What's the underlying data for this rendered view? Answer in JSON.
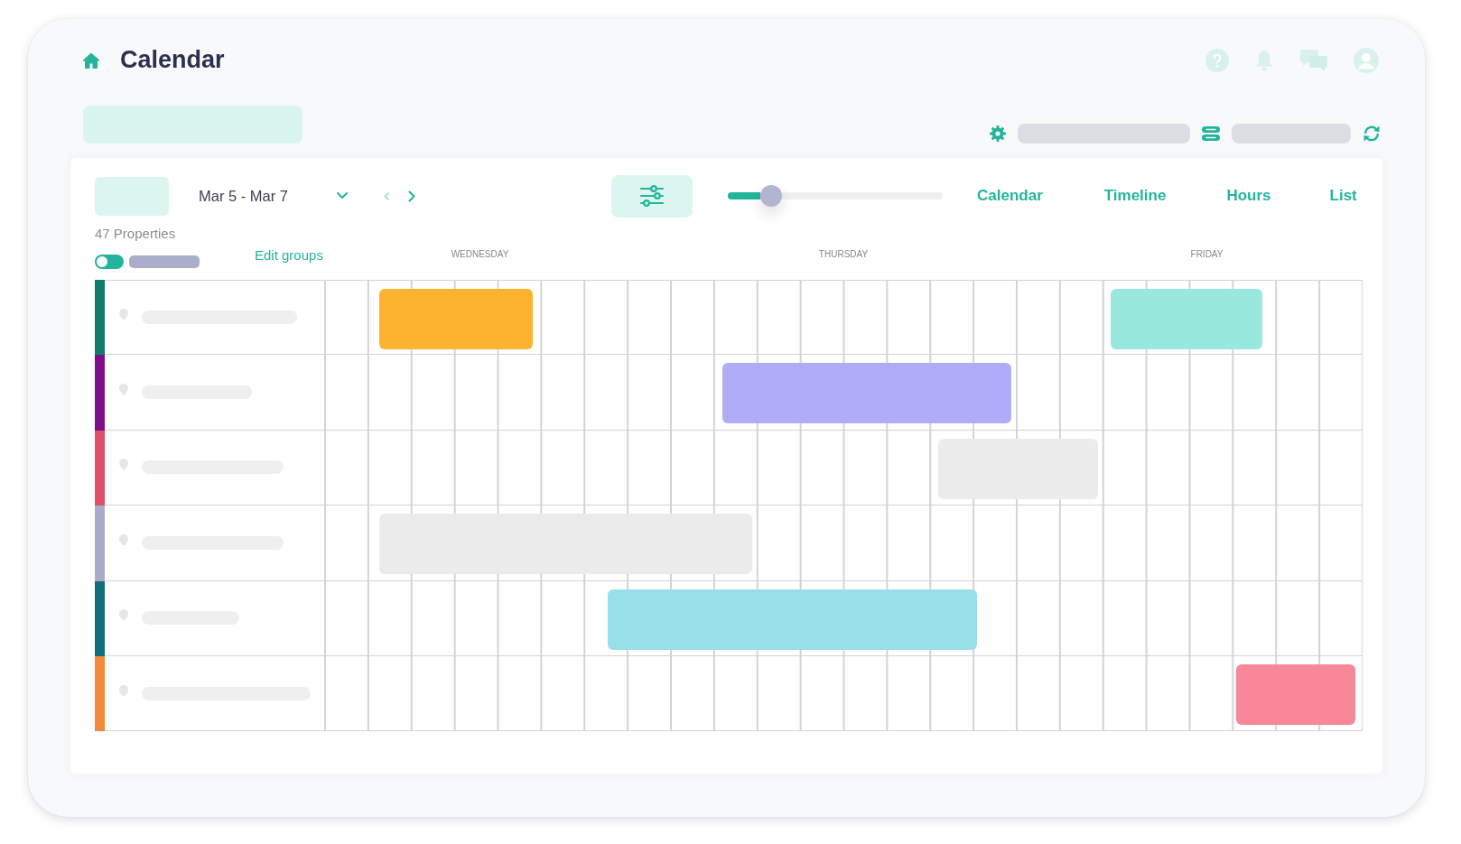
{
  "header": {
    "title": "Calendar"
  },
  "toolbar": {
    "date_range": "Mar 5 - Mar 7",
    "date_nav": [
      {
        "kind": "previous",
        "disabled": true
      },
      {
        "kind": "next",
        "disabled": false
      }
    ],
    "zoom_slider": {
      "level": 0.2
    },
    "views": [
      {
        "label": "Calendar"
      },
      {
        "label": "Timeline"
      },
      {
        "label": "Hours"
      },
      {
        "label": "List"
      }
    ]
  },
  "groups": {
    "count": "47 Properties",
    "toggle": {
      "on": false
    },
    "edit_link": "Edit groups"
  },
  "days": [
    "WEDNESDAY",
    "THURSDAY",
    "FRIDAY"
  ],
  "rows": [
    {
      "color": "#0f7d6b",
      "events": [
        {
          "color": "#fdb32f"
        },
        {
          "color": "#98e8dd"
        }
      ]
    },
    {
      "color": "#7d1088",
      "events": [
        {
          "color": "#b1acf8"
        }
      ]
    },
    {
      "color": "#e04e6b",
      "events": [
        {
          "color": "#ececec"
        }
      ]
    },
    {
      "color": "#aaabcb",
      "events": [
        {
          "color": "#ebebeb"
        }
      ]
    },
    {
      "color": "#0f6f7b",
      "events": [
        {
          "color": "#98dfea"
        }
      ]
    },
    {
      "color": "#f5883b",
      "events": [
        {
          "color": "#f88898"
        }
      ]
    }
  ]
}
